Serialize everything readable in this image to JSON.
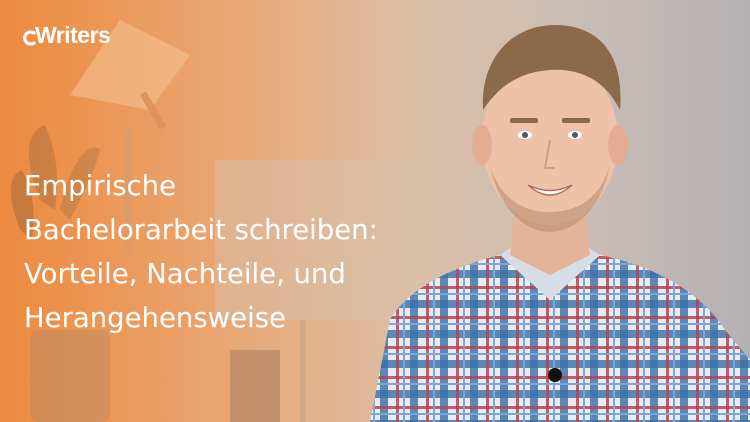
{
  "brand": {
    "logo_text": "Writers",
    "logo_mark_icon": "c-brand-mark"
  },
  "headline": {
    "lines": [
      "Empirische",
      "Bachelorarbeit schreiben:",
      "Vorteile, Nachteile, und",
      "Herangehensweise"
    ]
  },
  "colors": {
    "accent_orange": "#ec8a3f",
    "text": "#ffffff",
    "shirt_blue": "#3b6fa6",
    "shirt_red": "#b8434f"
  },
  "photo": {
    "subject_icon": "presenter-photo",
    "props": [
      "desk-lamp-icon",
      "plant-icon",
      "monitor-icon"
    ]
  }
}
